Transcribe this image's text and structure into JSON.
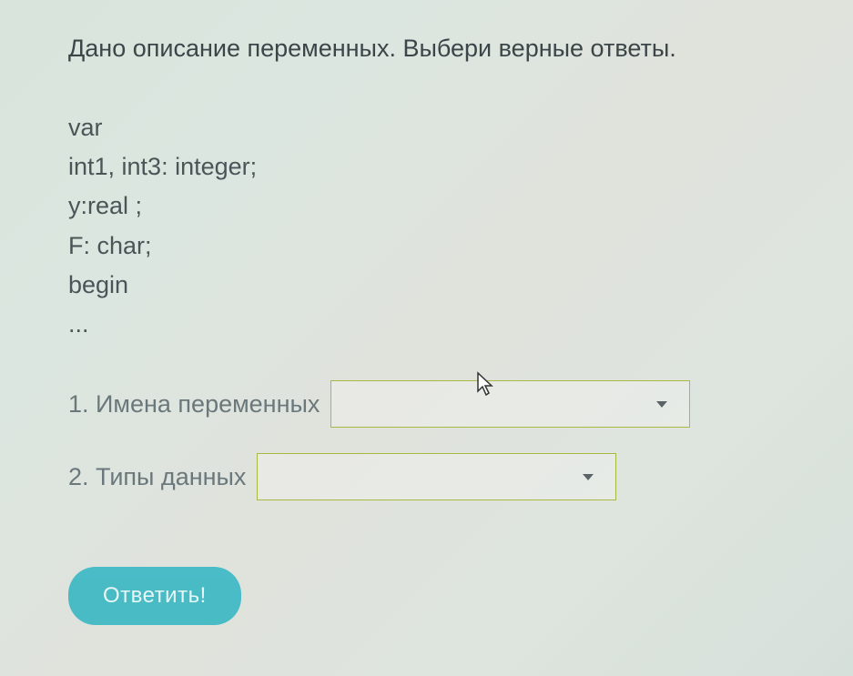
{
  "question": {
    "title": "Дано описание переменных. Выбери верные ответы.",
    "code_lines": [
      "var",
      "int1, int3: integer;",
      "y:real ;",
      "F: char;",
      "begin",
      "..."
    ],
    "items": [
      {
        "label": "1. Имена переменных",
        "selected": ""
      },
      {
        "label": "2. Типы данных",
        "selected": ""
      }
    ]
  },
  "submit_label": "Ответить!"
}
